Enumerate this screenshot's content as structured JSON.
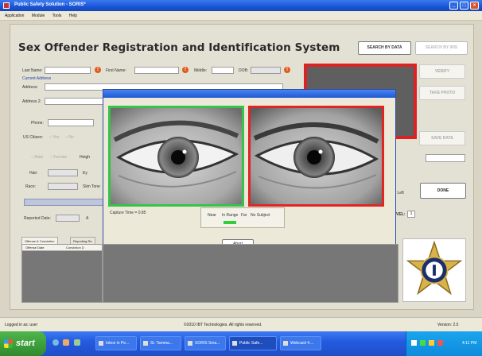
{
  "window": {
    "title": "Public Safety Solution - SORIS*",
    "menu": [
      "Application",
      "Module",
      "Tools",
      "Help"
    ]
  },
  "app": {
    "title": "Sex Offender Registration and Identification System",
    "search_by_data": "SEARCH BY DATA",
    "search_by_iris": "SEARCH BY IRIS",
    "verify": "VERIFY",
    "take_photo": "TAKE PHOTO",
    "save_data": "SAVE DATA",
    "done": "DONE"
  },
  "form": {
    "last_name": "Last Name:",
    "first_name": "First Name:",
    "middle": "Middle:",
    "dob": "DOB:",
    "current_address": "Current Address",
    "address": "Address:",
    "address2": "Address 2:",
    "phone": "Phone:",
    "us_citizen": "US Citizen:",
    "yes": "Yes",
    "no": "No",
    "male": "Male",
    "female": "Female",
    "height": "Heigh",
    "hair": "Hair:",
    "eyes": "Ey",
    "race": "Race:",
    "skin_tone": "Skin Tone",
    "reported_date": "Reported Date:",
    "a_label": "A",
    "left": "Left",
    "level": "VEL:",
    "level_value": "1"
  },
  "tabs": [
    "Offense & Conviction",
    "Reporting Re"
  ],
  "table_columns": [
    "Offense Date",
    "Conviction D"
  ],
  "dialog": {
    "capture_time": "Capture Time = 0.85",
    "range_near": "Near",
    "range_in": "In Range",
    "range_far": "Far",
    "range_none": "No Subject",
    "abort": "Abort"
  },
  "status": {
    "logged_in": "Logged in as: user",
    "copyright": "©2010 IBT Technologies. All rights reserved.",
    "version": "Version: 2.5"
  },
  "taskbar": {
    "start": "start",
    "tasks": [
      "Inbox in Pe...",
      "St. Tamma...",
      "SORIS Sma...",
      "Public Safe...",
      "Webcard 4...."
    ],
    "clock": "4:11 PM"
  },
  "colors": {
    "left_eye_frame": "#37c24a",
    "right_eye_frame": "#e12424",
    "photo_frame": "#dd2222"
  }
}
